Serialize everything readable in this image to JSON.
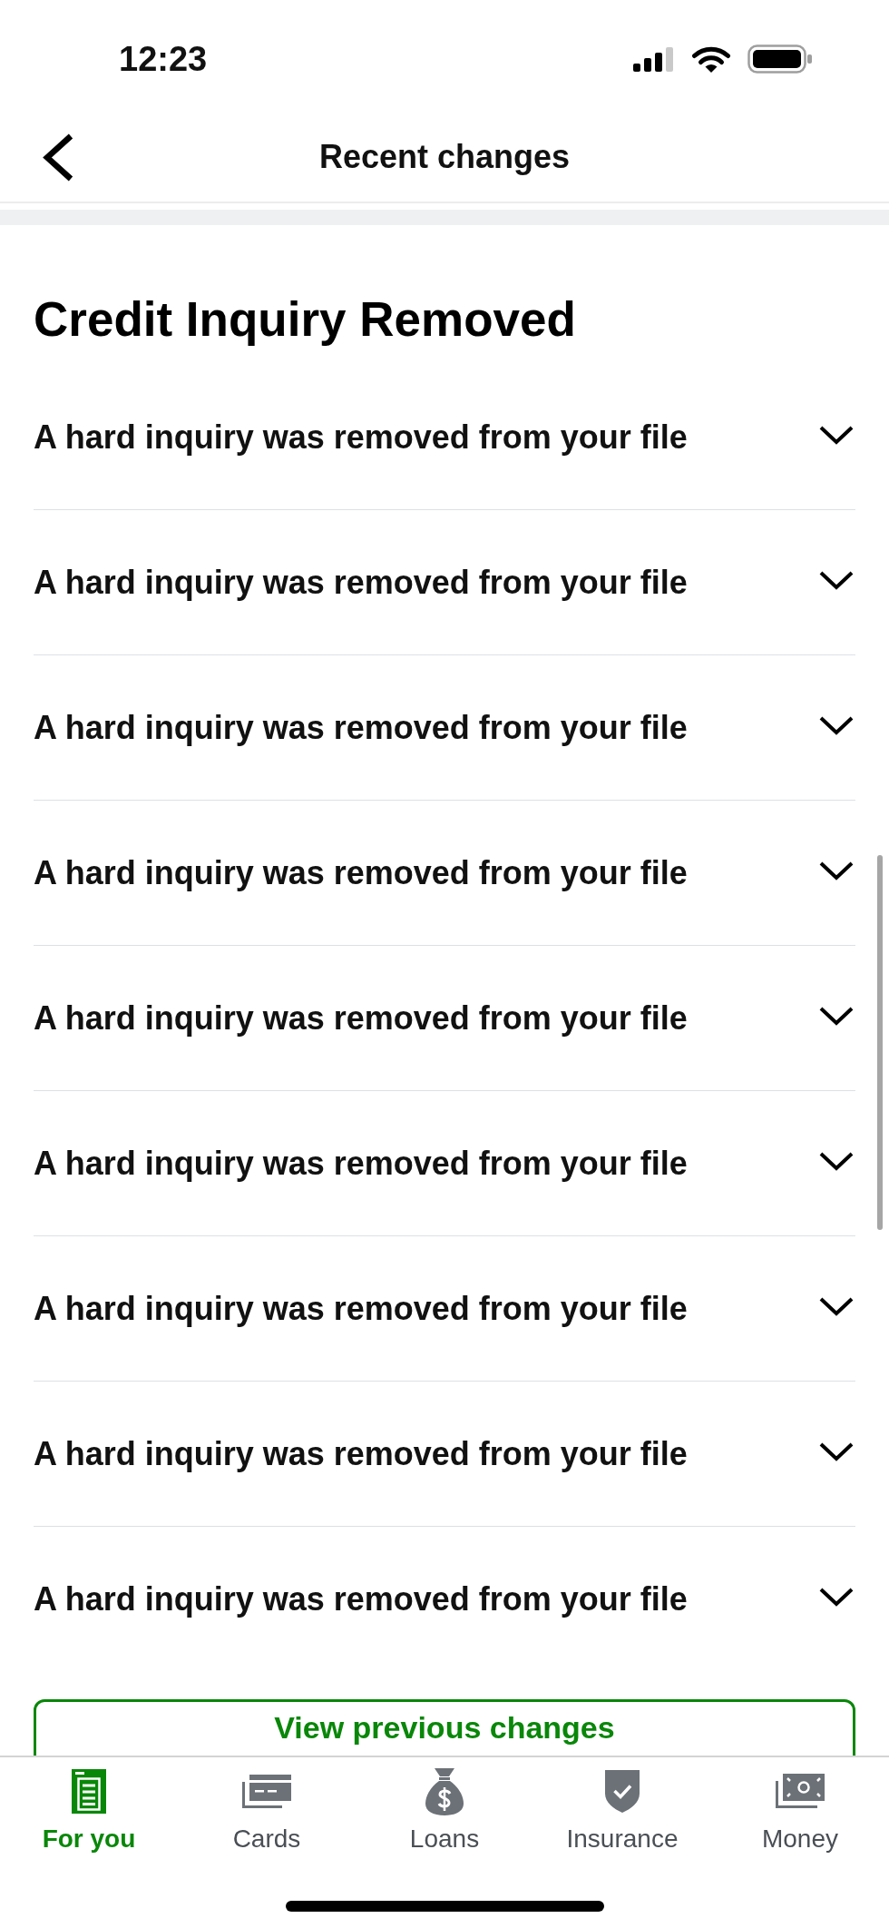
{
  "status_bar": {
    "time": "12:23"
  },
  "header": {
    "title": "Recent changes"
  },
  "section": {
    "title": "Credit Inquiry Removed",
    "items": [
      {
        "text": "A hard inquiry was removed from your file",
        "expanded": false
      },
      {
        "text": "A hard inquiry was removed from your file",
        "expanded": false
      },
      {
        "text": "A hard inquiry was removed from your file",
        "expanded": false
      },
      {
        "text": "A hard inquiry was removed from your file",
        "expanded": false
      },
      {
        "text": "A hard inquiry was removed from your file",
        "expanded": false
      },
      {
        "text": "A hard inquiry was removed from your file",
        "expanded": false
      },
      {
        "text": "A hard inquiry was removed from your file",
        "expanded": false
      },
      {
        "text": "A hard inquiry was removed from your file",
        "expanded": false
      },
      {
        "text": "A hard inquiry was removed from your file",
        "expanded": false
      }
    ]
  },
  "button": {
    "label": "View previous changes"
  },
  "tab_bar": {
    "tabs": [
      {
        "label": "For you",
        "kind": "document",
        "selected": true
      },
      {
        "label": "Cards",
        "kind": "cards",
        "selected": false
      },
      {
        "label": "Loans",
        "kind": "bag",
        "selected": false
      },
      {
        "label": "Insurance",
        "kind": "shield",
        "selected": false
      },
      {
        "label": "Money",
        "kind": "banknote",
        "selected": false
      }
    ]
  }
}
